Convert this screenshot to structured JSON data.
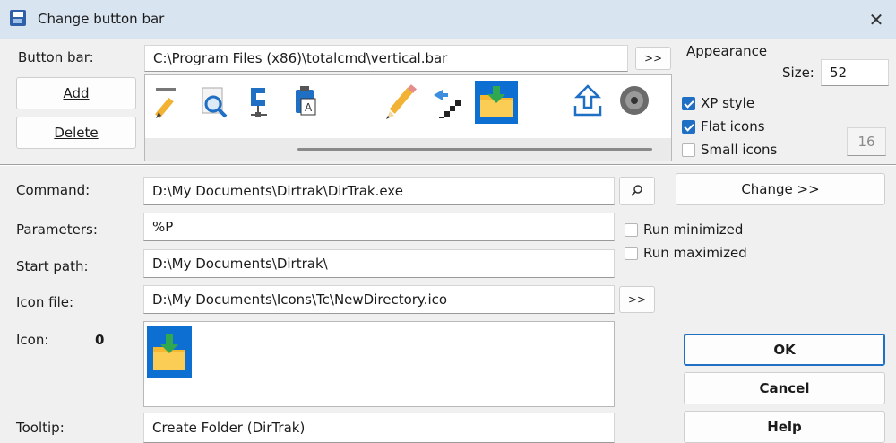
{
  "window": {
    "title": "Change button bar"
  },
  "buttonbar": {
    "label": "Button bar:",
    "path": "C:\\Program Files (x86)\\totalcmd\\vertical.bar",
    "browse_label": ">>",
    "add_label": "Add",
    "delete_label": "Delete",
    "icons": [
      "ruler-pencil-icon",
      "magnifier-icon",
      "network-drive-icon",
      "clipboard-icon",
      "pencil-icon",
      "move-stairs-icon",
      "new-folder-icon",
      "upload-icon",
      "disc-icon"
    ],
    "selected_icon": "new-folder-icon"
  },
  "appearance": {
    "title": "Appearance",
    "size_label": "Size:",
    "size_value": "52",
    "xp_style_label": "XP style",
    "xp_style_checked": true,
    "flat_icons_label": "Flat icons",
    "flat_icons_checked": true,
    "small_icons_label": "Small icons",
    "small_icons_checked": false,
    "small_icons_size": "16"
  },
  "command": {
    "label": "Command:",
    "value": "D:\\My Documents\\Dirtrak\\DirTrak.exe",
    "search_icon": "magnifier-icon",
    "change_label": "Change >>"
  },
  "parameters": {
    "label": "Parameters:",
    "value": "%P",
    "run_minimized_label": "Run minimized",
    "run_minimized_checked": false,
    "run_maximized_label": "Run maximized",
    "run_maximized_checked": false
  },
  "start_path": {
    "label": "Start path:",
    "value": "D:\\My Documents\\Dirtrak\\"
  },
  "icon_file": {
    "label": "Icon file:",
    "value": "D:\\My Documents\\Icons\\Tc\\NewDirectory.ico",
    "browse_label": ">>"
  },
  "icon": {
    "label": "Icon:",
    "index": "0",
    "preview_icon": "new-folder-icon"
  },
  "tooltip": {
    "label": "Tooltip:",
    "value": "Create Folder (DirTrak)"
  },
  "buttons": {
    "ok_label": "OK",
    "cancel_label": "Cancel",
    "help_label": "Help"
  }
}
